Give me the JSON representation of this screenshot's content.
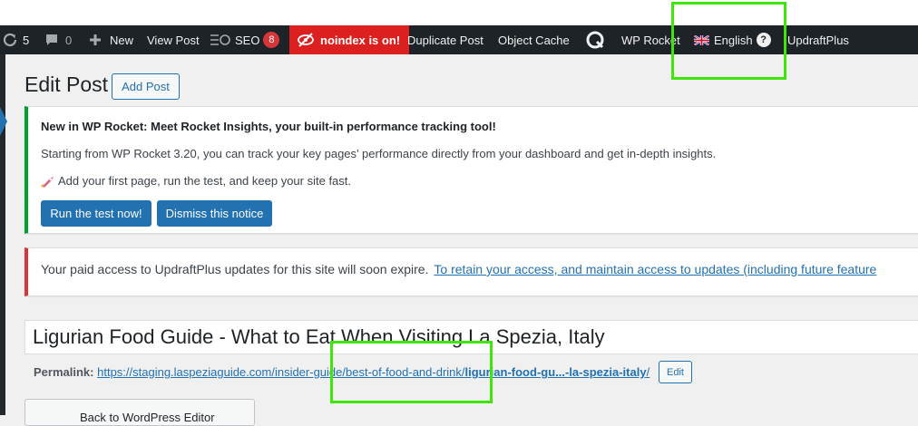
{
  "admin_bar": {
    "updates_count": "5",
    "comments_count": "0",
    "new_label": "New",
    "view_post_label": "View Post",
    "seo_label": "SEO",
    "seo_badge": "8",
    "noindex_label": "noindex is on!",
    "duplicate_post_label": "Duplicate Post",
    "object_cache_label": "Object Cache",
    "wp_rocket_label": "WP Rocket",
    "language_label": "English",
    "help_glyph": "?",
    "updraftplus_label": "UpdraftPlus"
  },
  "page": {
    "title": "Edit Post",
    "add_post_label": "Add Post"
  },
  "rocket_notice": {
    "heading": "New in WP Rocket: Meet Rocket Insights, your built-in performance tracking tool!",
    "body": "Starting from WP Rocket 3.20, you can track your key pages’ performance directly from your dashboard and get in-depth insights.",
    "cta_text": "Add your first page, run the test, and keep your site fast.",
    "run_test_label": "Run the test now!",
    "dismiss_label": "Dismiss this notice"
  },
  "updraft_notice": {
    "text": "Your paid access to UpdraftPlus updates for this site will soon expire.",
    "link": "To retain your access, and maintain access to updates (including future feature"
  },
  "post": {
    "title": "Ligurian Food Guide - What to Eat When Visiting La Spezia, Italy",
    "permalink_label": "Permalink:",
    "permalink_base": "https://staging.laspeziaguide.com/insider-guide/best-of-food-and-drink/",
    "permalink_slug": "ligurian-food-gu...-la-spezia-italy",
    "permalink_end": "/",
    "edit_label": "Edit"
  },
  "editor": {
    "switch_label": "Back to WordPress Editor"
  },
  "colors": {
    "admin_bar": "#1d2327",
    "accent": "#2271b1",
    "noindex": "#dc1f1f",
    "notice_success": "#00a32a",
    "notice_error": "#d63638",
    "highlight": "#3ee60a"
  }
}
